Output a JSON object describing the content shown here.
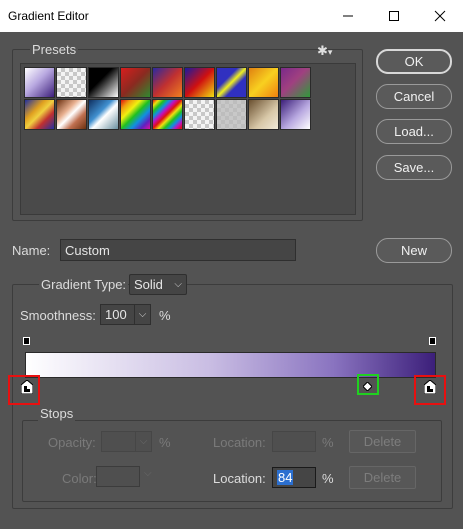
{
  "window": {
    "title": "Gradient Editor",
    "controls": [
      "minimize",
      "maximize",
      "close"
    ]
  },
  "presets": {
    "label": "Presets",
    "menu_icon": "gear-icon"
  },
  "buttons": {
    "ok": "OK",
    "cancel": "Cancel",
    "load": "Load...",
    "save": "Save...",
    "new": "New"
  },
  "name": {
    "label": "Name:",
    "value": "Custom"
  },
  "gradient": {
    "type_label": "Gradient Type:",
    "type_value": "Solid",
    "smoothness_label": "Smoothness:",
    "smoothness_value": "100",
    "percent": "%",
    "colors": {
      "start": "#ffffff",
      "end": "#3c1f7a"
    },
    "selected_color_stop_location": 84
  },
  "stops": {
    "label": "Stops",
    "opacity_label": "Opacity:",
    "percent": "%",
    "location_label": "Location:",
    "delete_label": "Delete",
    "color_label": "Color:",
    "color_location_value": "84"
  }
}
